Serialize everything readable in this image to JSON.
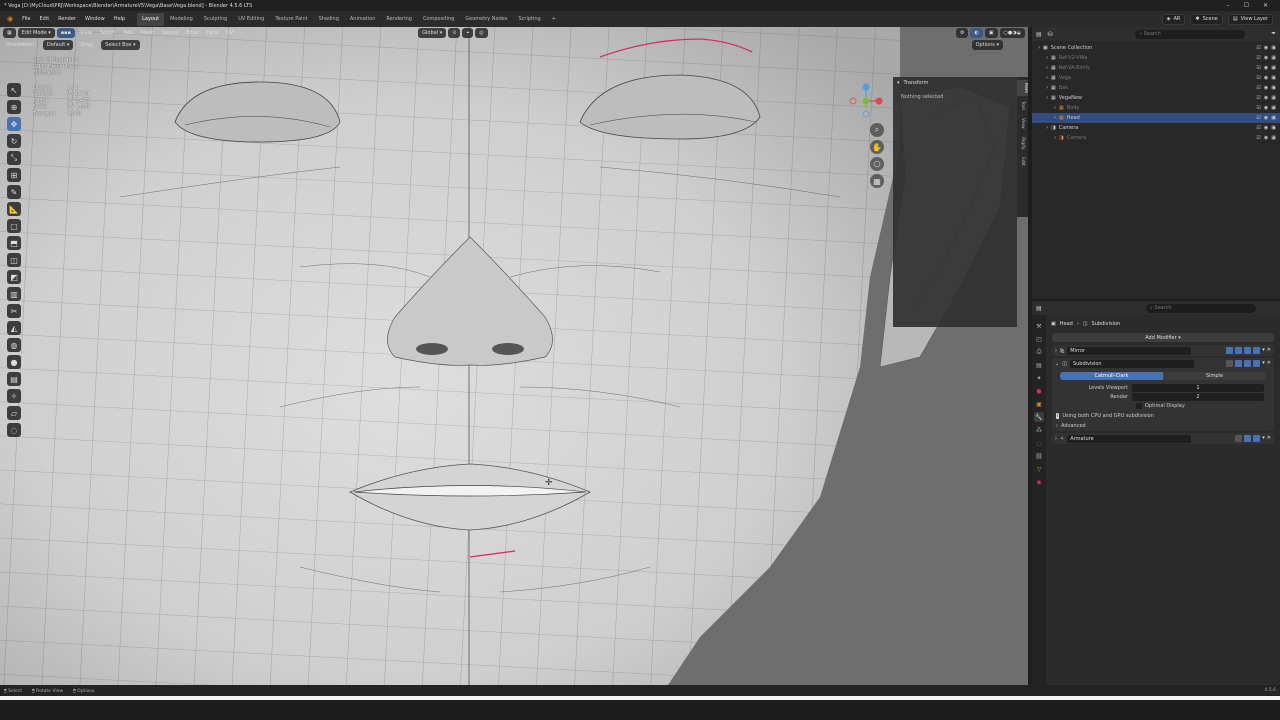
{
  "window": {
    "title": "* Vega [D:\\MyCloud\\PRJ\\Workspace\\Blender\\ArmatureV5\\Vega\\Base\\Vega.blend] - Blender 4.5.6 LTS",
    "controls": [
      "–",
      "☐",
      "✕"
    ]
  },
  "menu": {
    "items": [
      "File",
      "Edit",
      "Render",
      "Window",
      "Help"
    ],
    "workspaces": [
      "Layout",
      "Modeling",
      "Sculpting",
      "UV Editing",
      "Texture Paint",
      "Shading",
      "Animation",
      "Rendering",
      "Compositing",
      "Geometry Nodes",
      "Scripting"
    ],
    "active_workspace": "Layout",
    "add_tab": "+",
    "scene_label": "Scene",
    "view_layer_label": "View Layer",
    "render_engine": "AR"
  },
  "viewport_header": {
    "mode": "Edit Mode",
    "menus": [
      "View",
      "Select",
      "Add",
      "Mesh",
      "Vertex",
      "Edge",
      "Face",
      "UV"
    ],
    "transform_orientation": "Global",
    "options": "Options"
  },
  "tool_settings": {
    "orientation_label": "Orientation:",
    "orientation_value": "Default",
    "drag_label": "Drag:",
    "drag_value": "Select Box"
  },
  "overlay": {
    "view_name": "User Orthographic",
    "object_name": "(210) Head | Head",
    "units": "Millimeters",
    "stats": [
      {
        "label": "Objects",
        "value": "1 / 1"
      },
      {
        "label": "Vertices",
        "value": "0 / 1,714"
      },
      {
        "label": "Edges",
        "value": "0 / 3,473"
      },
      {
        "label": "Faces",
        "value": "0 / 1,680"
      },
      {
        "label": "Triangles",
        "value": "3,360"
      }
    ]
  },
  "npanel": {
    "header": "Transform",
    "empty_text": "Nothing selected",
    "tabs": [
      "Item",
      "Tool",
      "View",
      "Rigify",
      "Edit"
    ],
    "active_tab": "Item"
  },
  "outliner": {
    "search_placeholder": "Search",
    "rows": [
      {
        "label": "Scene Collection",
        "indent": 0,
        "selected": false,
        "dim": false
      },
      {
        "label": "Ref-V2-VWa",
        "indent": 1,
        "selected": false,
        "dim": true
      },
      {
        "label": "Ref-VA-Emily",
        "indent": 1,
        "selected": false,
        "dim": true
      },
      {
        "label": "Vega",
        "indent": 1,
        "selected": false,
        "dim": true
      },
      {
        "label": "Bak",
        "indent": 1,
        "selected": false,
        "dim": true
      },
      {
        "label": "VegaNew",
        "indent": 1,
        "selected": false,
        "dim": false
      },
      {
        "label": "Body",
        "indent": 2,
        "selected": false,
        "dim": true
      },
      {
        "label": "Head",
        "indent": 2,
        "selected": true,
        "dim": false
      },
      {
        "label": "Camera",
        "indent": 1,
        "selected": false,
        "dim": false
      },
      {
        "label": "Camera",
        "indent": 2,
        "selected": false,
        "dim": true
      }
    ]
  },
  "properties": {
    "search_placeholder": "Search",
    "breadcrumb_object": "Head",
    "breadcrumb_sep": "›",
    "breadcrumb_context": "Subdivision",
    "add_modifier": "Add Modifier",
    "modifiers": {
      "mirror": "Mirror",
      "subdivision": "Subdivision",
      "armature": "Armature"
    },
    "subdiv": {
      "method_options": [
        "Catmull-Clark",
        "Simple"
      ],
      "active_method": "Catmull-Clark",
      "levels_viewport_label": "Levels Viewport",
      "levels_viewport": "1",
      "render_label": "Render",
      "render_levels": "2",
      "optimal_display": "Optimal Display",
      "info_text": "Using both CPU and GPU subdivision",
      "advanced": "Advanced"
    }
  },
  "statusbar": {
    "select": "Select",
    "rotate_view": "Rotate View",
    "options": "Options",
    "version": "4.5.6"
  },
  "colors": {
    "accent": "#4772b3",
    "selected_row": "#334d80",
    "seam": "#d0306a",
    "mesh_bg": "#6e6e6e"
  }
}
